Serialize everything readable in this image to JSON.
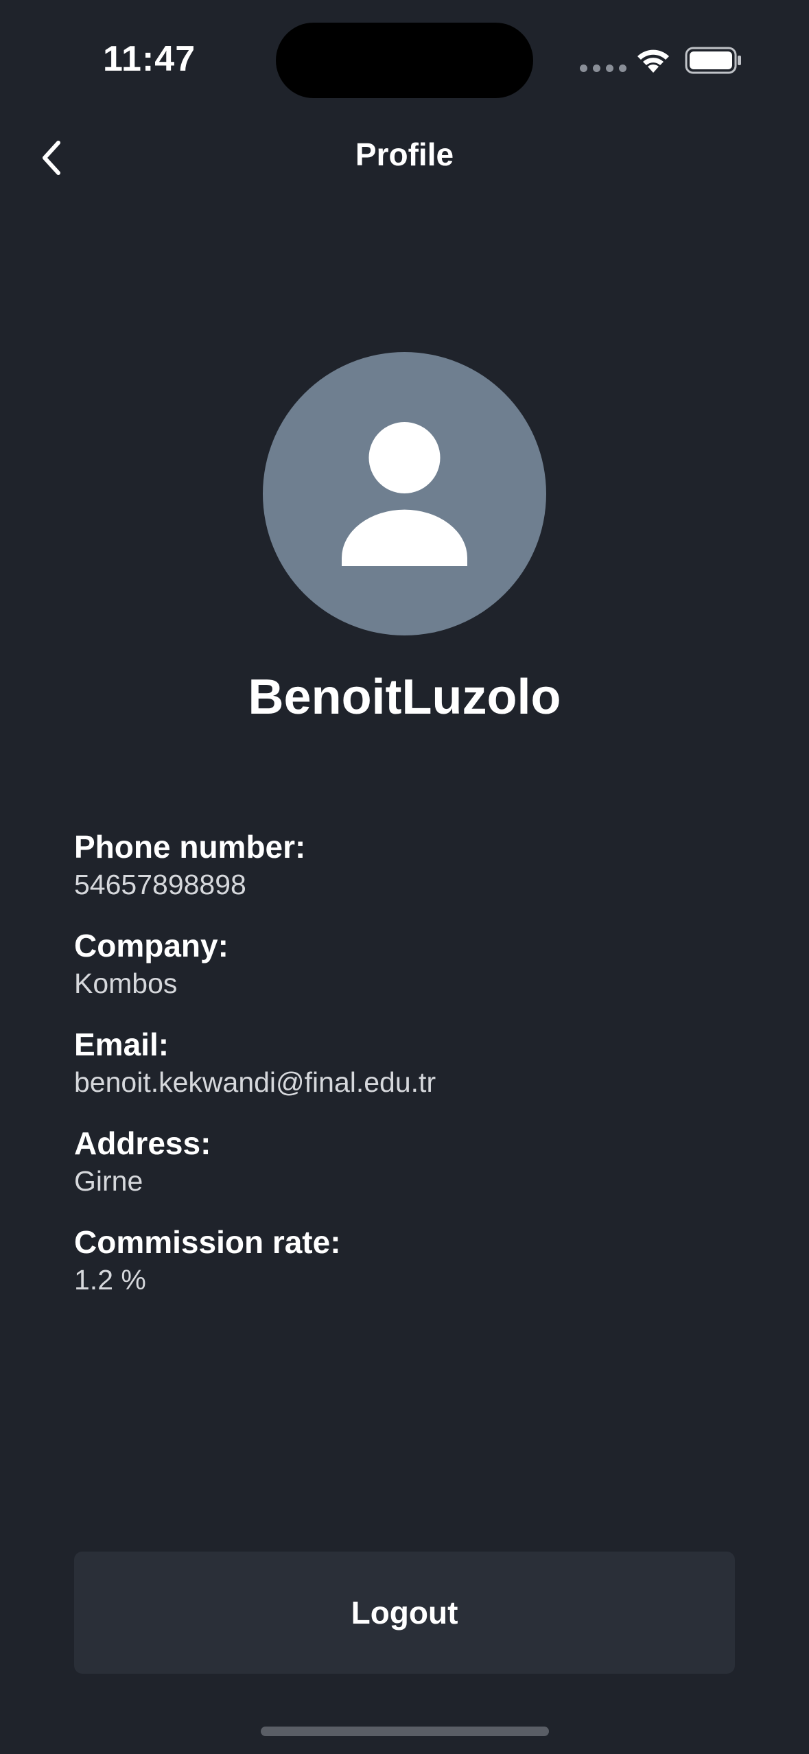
{
  "status_bar": {
    "time": "11:47"
  },
  "nav": {
    "title": "Profile",
    "back_icon": "chevron-left-icon"
  },
  "profile": {
    "avatar_icon": "person-icon",
    "name": "BenoitLuzolo",
    "fields": [
      {
        "label": "Phone number:",
        "value": "54657898898"
      },
      {
        "label": "Company:",
        "value": "Kombos"
      },
      {
        "label": "Email:",
        "value": "benoit.kekwandi@final.edu.tr"
      },
      {
        "label": "Address:",
        "value": "Girne"
      },
      {
        "label": "Commission rate:",
        "value": "1.2 %"
      }
    ]
  },
  "actions": {
    "logout_label": "Logout"
  },
  "colors": {
    "background": "#1f232b",
    "avatar_bg": "#6f7f90",
    "button_bg": "#2a2f38",
    "text_primary": "#ffffff",
    "text_secondary": "#d6d8dc"
  }
}
